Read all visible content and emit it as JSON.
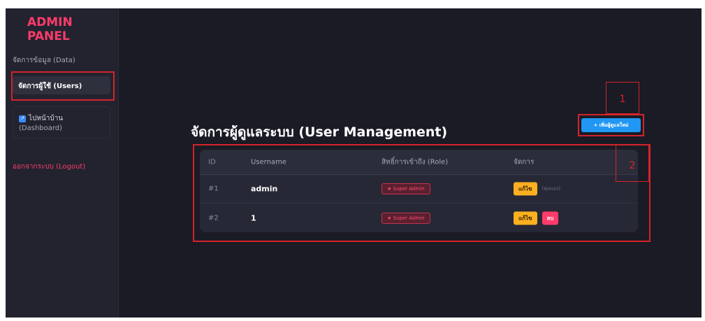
{
  "sidebar": {
    "brand": "ADMIN PANEL",
    "items": {
      "data": "จัดการข้อมูล (Data)",
      "users": "จัดการผู้ใช้ (Users)",
      "home_line1": "ไปหน้าบ้าน",
      "home_line2": "(Dashboard)",
      "logout": "ออกจากระบบ (Logout)"
    }
  },
  "main": {
    "title": "จัดการผู้ดูแลระบบ (User Management)",
    "add_button": "+ เพิ่มผู้ดูแลใหม่",
    "table": {
      "headers": [
        "ID",
        "Username",
        "สิทธิ์การเข้าถึง (Role)",
        "จัดการ"
      ],
      "rows": [
        {
          "id": "#1",
          "username": "admin",
          "role": "★ Super Admin",
          "edit": "แก้ไข",
          "note": "(คุณเอง)"
        },
        {
          "id": "#2",
          "username": "1",
          "role": "★ Super Admin",
          "edit": "แก้ไข",
          "delete": "ลบ"
        }
      ]
    }
  },
  "annotations": {
    "label_1": "1",
    "label_2": "2"
  },
  "colors": {
    "accent": "#ff3b6b",
    "primary_button": "#2196f3",
    "edit_button": "#ffb020",
    "highlight": "#d4232a"
  }
}
